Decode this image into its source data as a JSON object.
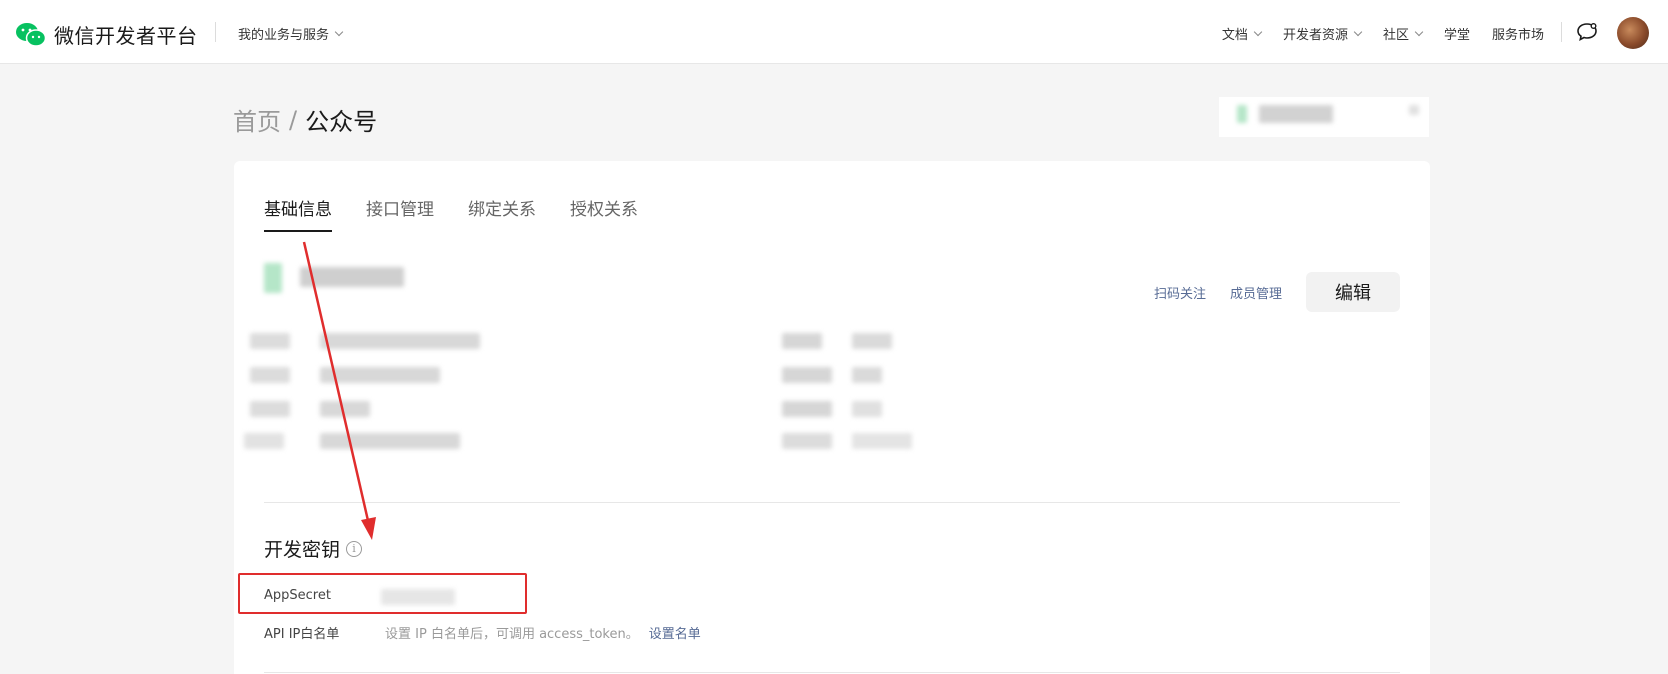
{
  "header": {
    "brand": "微信开发者平台",
    "biz_menu": "我的业务与服务",
    "nav": [
      {
        "label": "文档",
        "dropdown": true
      },
      {
        "label": "开发者资源",
        "dropdown": true
      },
      {
        "label": "社区",
        "dropdown": true
      },
      {
        "label": "学堂",
        "dropdown": false
      },
      {
        "label": "服务市场",
        "dropdown": false
      }
    ],
    "icons": {
      "brand": "wechat-logo-icon",
      "chat": "chat-bubble-icon",
      "avatar": "user-avatar"
    },
    "brand_color": "#07c160"
  },
  "breadcrumb": {
    "home": "首页",
    "separator": "/",
    "current": "公众号"
  },
  "tabs": [
    {
      "label": "基础信息",
      "active": true
    },
    {
      "label": "接口管理",
      "active": false
    },
    {
      "label": "绑定关系",
      "active": false
    },
    {
      "label": "授权关系",
      "active": false
    }
  ],
  "actions": {
    "scan_follow": "扫码关注",
    "member_manage": "成员管理",
    "edit": "编辑"
  },
  "dev_key": {
    "title": "开发密钥",
    "app_secret_label": "AppSecret",
    "ip_whitelist_label": "API IP白名单",
    "ip_whitelist_hint": "设置 IP 白名单后，可调用 access_token。",
    "ip_whitelist_link": "设置名单"
  },
  "colors": {
    "link": "#576b95",
    "annotation": "#e02d2d",
    "background": "#f5f5f5"
  }
}
